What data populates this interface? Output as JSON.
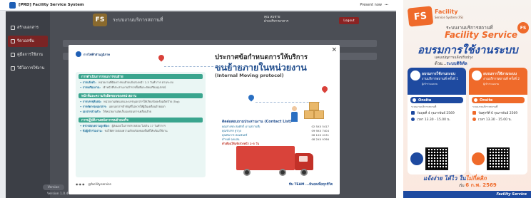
{
  "window": {
    "title": "[PRD] Facility Service System",
    "mode_label": "Present now",
    "more_label": "⋯"
  },
  "sidebar": {
    "items": [
      {
        "label": "สร้างเอกสาร"
      },
      {
        "label": "รีควอสชั่น"
      },
      {
        "label": "คู่มือการใช้งาน"
      },
      {
        "label": "วิดีโอการใช้งาน"
      }
    ],
    "version_pill": "Version",
    "version": "Version 1.0.4"
  },
  "header": {
    "app_badge": "FS",
    "title": "ระบบงานบริการสถานที่",
    "user_line1": "คุณ สมชาย",
    "user_line2": "ฝ่ายบริหารอาคาร",
    "logout": "Logout"
  },
  "modal": {
    "close": "×",
    "org": "การไฟฟ้าส่วนภูมิภาค",
    "title_line1": "ประกาศข้อกำหนดการให้บริการ",
    "title_line2": "ขนย้ายภายในหน่วยงาน",
    "title_line3": "(Internal Moving protocol)",
    "sections": [
      {
        "header": "การดำเนินการก่อนการขนย้าย",
        "rows": [
          {
            "k": "• การแจ้งคำ:",
            "v": "หน่วยงานที่ต้องการขนย้ายแจ้งล่วงหน้า 2-3 วันทำการ ผ่านระบบ"
          },
          {
            "k": "• การเตรียมงาน:",
            "v": "เจ้าหน้าที่ประสานงานสำรวจพื้นที่และจัดเตรียมอุปกรณ์"
          }
        ]
      },
      {
        "header": "หน้าที่และความรับผิดชอบของหน่วยงาน",
        "rows": [
          {
            "k": "• การบรรจุหีบห่อ:",
            "v": "หน่วยงานคัดแยกและบรรจุเอกสารให้เรียบร้อยพร้อมติดป้าย (Tag)"
          },
          {
            "k": "• การคัดกรองเอกสาร:",
            "v": "แยกเอกสารสำคัญที่ไม่ควรให้ผู้อื่นเคลื่อนย้ายออก"
          },
          {
            "k": "• เอกสารส่วนตัว:",
            "v": "ให้หน่วยงานจัดเก็บเองก่อนการเคลื่อนย้าย"
          }
        ]
      },
      {
        "header": "การปฏิบัติงานหลังการขนย้ายเสร็จ",
        "rows": [
          {
            "k": "• ตรวจสอบความถูกต้อง:",
            "v": "ผู้ส่งมอบในการตรวจสอบ ไม่เกิน 17 วันทำการ"
          },
          {
            "k": "• ข้อผู้เข้าร่วมงาน:",
            "v": "ขอให้ตรวจสอบความเรียบร้อยของพื้นที่ให้พร้อมใช้งาน"
          }
        ]
      }
    ],
    "contact": {
      "title": "ติดต่อสอบถามประสานงาน (Contact List)",
      "rows": [
        {
          "name": "คุณสายชล สมศักดิ์ (งานสถานที่)",
          "phone": "02 5XX 5417"
        },
        {
          "name": "คุณรักสรร ฐากุล",
          "phone": "09 9XX 7404"
        },
        {
          "name": "คุณพิพากร หอมจันทร์",
          "phone": "06 1XX 4131"
        },
        {
          "name": "ดำรงค์ ฉลแสน",
          "phone": "08 2XX 9766"
        }
      ],
      "note": "คำเตือนให้แจ้งล่วงหน้า 2-3 วัน"
    },
    "footer_icons": "◉◉◉",
    "footer_text": "@facility.service",
    "team": "ทีม TEAM ...มีนยลเพื่อทุกชีวิต"
  },
  "poster": {
    "logo": "FS",
    "logo_label": "Facility",
    "logo_sub": "Service System (FS)",
    "badge": "FS",
    "line1": "ระบบงานบริการสถานที่",
    "line2": "Facility Service",
    "line3": "อบรมการใช้งานระบบ",
    "line4": "แคมเปญการแจ้งปรับปรุง",
    "line5_prefix": "ด้วย...",
    "line5_highlight": "ระบบดิจิทัล",
    "cards": [
      {
        "title": "อบรมการใช้งานระบบ",
        "subtitle": "งานบริการสถานที่ ครั้งที่ 1",
        "note": "ผู้เข้าร่วมอบรม",
        "onsite": "Onsite",
        "desc": "ระบบงานบริการสถานที่",
        "date": "วันพุธที่ 4 กุมภาพันธ์ 2569",
        "time": "เวลา 13.30 - 15.00 น."
      },
      {
        "title": "อบรมการใช้งานระบบ",
        "subtitle": "งานบริการสถานที่ ครั้งที่ 2",
        "note": "ผู้เข้าร่วมอบรม",
        "onsite": "Onsite",
        "desc": "ระบบงานบริการสถานที่",
        "date": "วันศุกร์ที่ 6 กุมภาพันธ์ 2569",
        "time": "เวลา 13.30 - 15.00 น."
      }
    ],
    "footer1_prefix": "แจ้งง่าย ได้ไว ใน",
    "footer1_highlight": "ไม่กี่คลิก",
    "footer2_prefix": "เริ่ม",
    "footer2_highlight": "6 ก.พ. 2569",
    "bottom": "Facility Service"
  }
}
